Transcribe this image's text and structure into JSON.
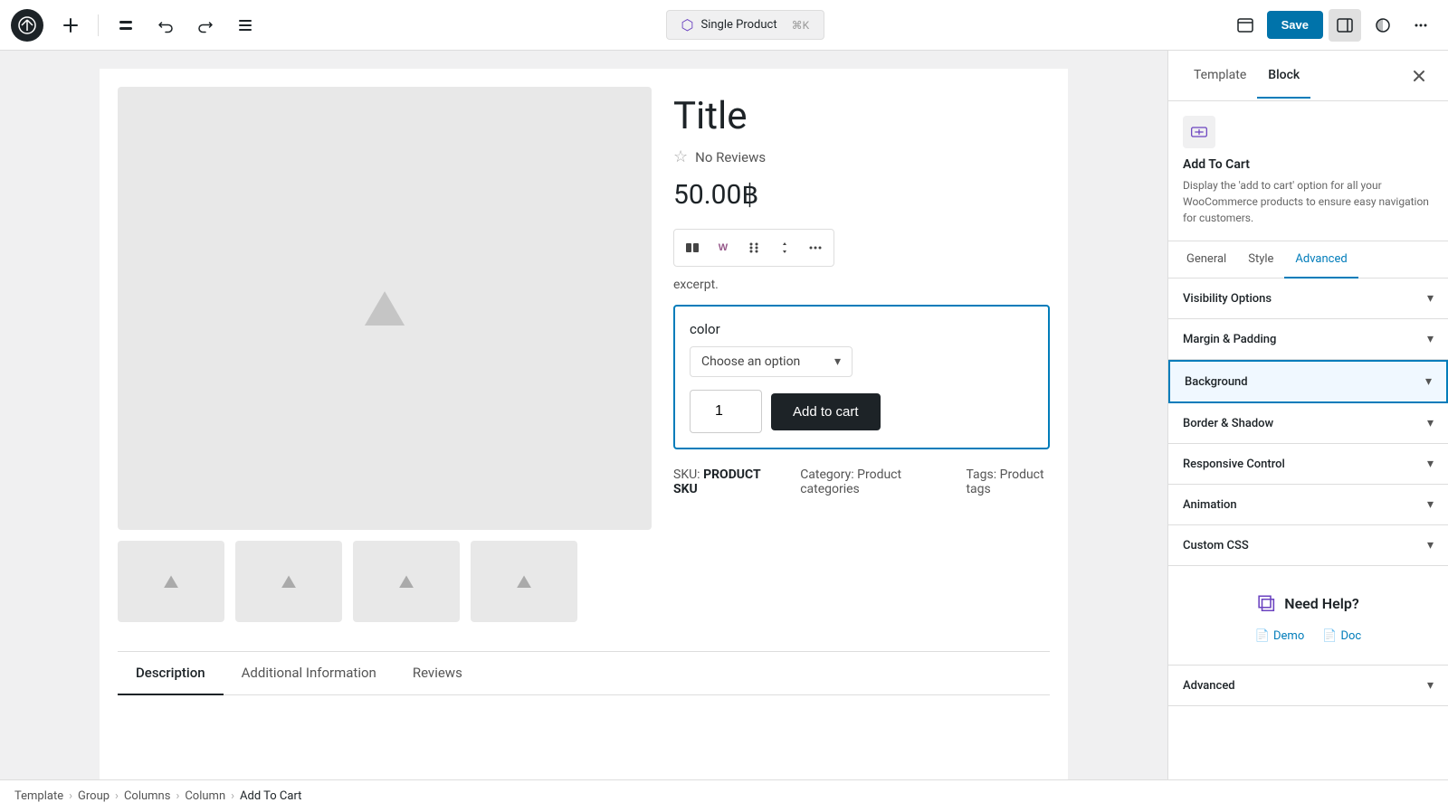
{
  "toolbar": {
    "template_label": "Single Product",
    "shortcut": "⌘K",
    "save_label": "Save"
  },
  "breadcrumb": {
    "items": [
      "Template",
      "Group",
      "Columns",
      "Column",
      "Add To Cart"
    ]
  },
  "panel": {
    "tab_template": "Template",
    "tab_block": "Block",
    "block_name": "Add To Cart",
    "block_desc": "Display the 'add to cart' option for all your WooCommerce products to ensure easy navigation for customers.",
    "sub_tabs": [
      "General",
      "Style",
      "Advanced"
    ],
    "active_sub_tab": "Advanced",
    "sections": [
      {
        "label": "Visibility Options",
        "active": false
      },
      {
        "label": "Margin & Padding",
        "active": false
      },
      {
        "label": "Background",
        "active": true
      },
      {
        "label": "Border & Shadow",
        "active": false
      },
      {
        "label": "Responsive Control",
        "active": false
      },
      {
        "label": "Animation",
        "active": false
      },
      {
        "label": "Custom CSS",
        "active": false
      }
    ],
    "help_title": "Need Help?",
    "help_demo": "Demo",
    "help_doc": "Doc",
    "advanced_bottom": "Advanced"
  },
  "product": {
    "title": "Title",
    "reviews": "No Reviews",
    "price": "50.00฿",
    "excerpt": "excerpt.",
    "color_label": "color",
    "choose_option": "Choose an option",
    "qty": "1",
    "add_to_cart_btn": "Add to cart",
    "sku_label": "SKU:",
    "sku_value": "PRODUCT SKU",
    "category_label": "Category:",
    "category_value": "Product categories",
    "tags_label": "Tags:",
    "tags_value": "Product tags",
    "tabs": [
      "Description",
      "Additional Information",
      "Reviews"
    ],
    "active_tab": "Description"
  }
}
